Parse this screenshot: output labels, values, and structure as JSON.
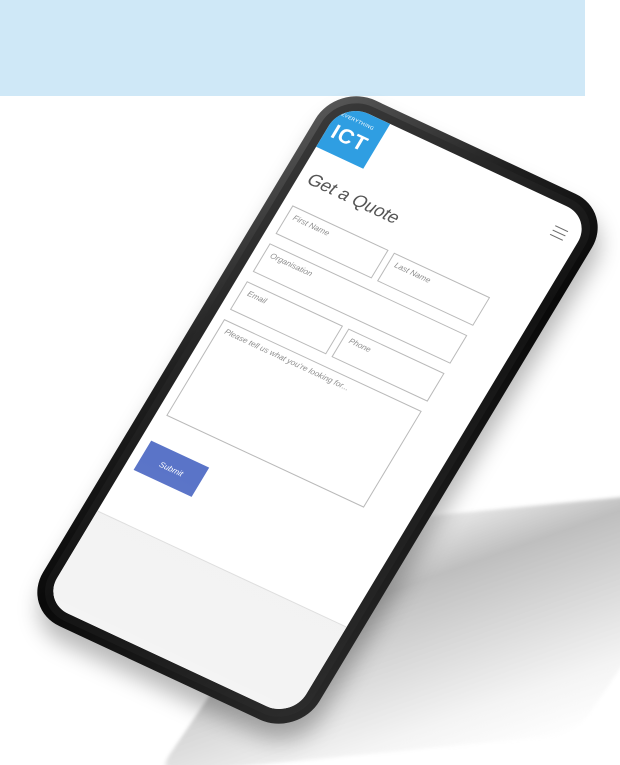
{
  "logo": {
    "top_text": "EVERYTHING",
    "main_text": "ICT",
    "color": "#2f9ee2"
  },
  "header": {
    "menu_icon": "hamburger-menu-icon"
  },
  "form": {
    "title": "Get a Quote",
    "fields": {
      "first_name": "First Name",
      "last_name": "Last Name",
      "organisation": "Organisation",
      "email": "Email",
      "phone": "Phone",
      "message": "Please tell us what you’re looking for..."
    },
    "submit_label": "Submit",
    "submit_color": "#5a74c8"
  },
  "background": {
    "panel_color": "#cfe8f7"
  }
}
